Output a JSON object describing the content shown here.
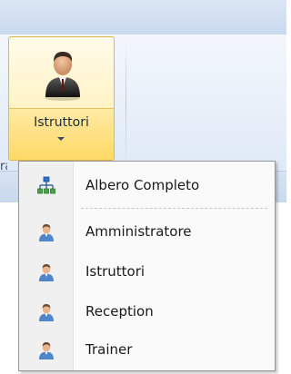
{
  "ribbon": {
    "button_label": "Istruttori",
    "edge_text": "ra"
  },
  "menu": {
    "items": [
      {
        "label": "Albero Completo",
        "icon": "org-tree-icon"
      },
      {
        "label": "Amministratore",
        "icon": "user-icon"
      },
      {
        "label": "Istruttori",
        "icon": "user-icon"
      },
      {
        "label": "Reception",
        "icon": "user-icon"
      },
      {
        "label": "Trainer",
        "icon": "user-icon"
      }
    ]
  },
  "colors": {
    "ribbon_bg": "#e4edf8",
    "button_highlight": "#ffd966",
    "menu_bg": "#fafafa",
    "menu_gutter": "#f0f0f0"
  }
}
